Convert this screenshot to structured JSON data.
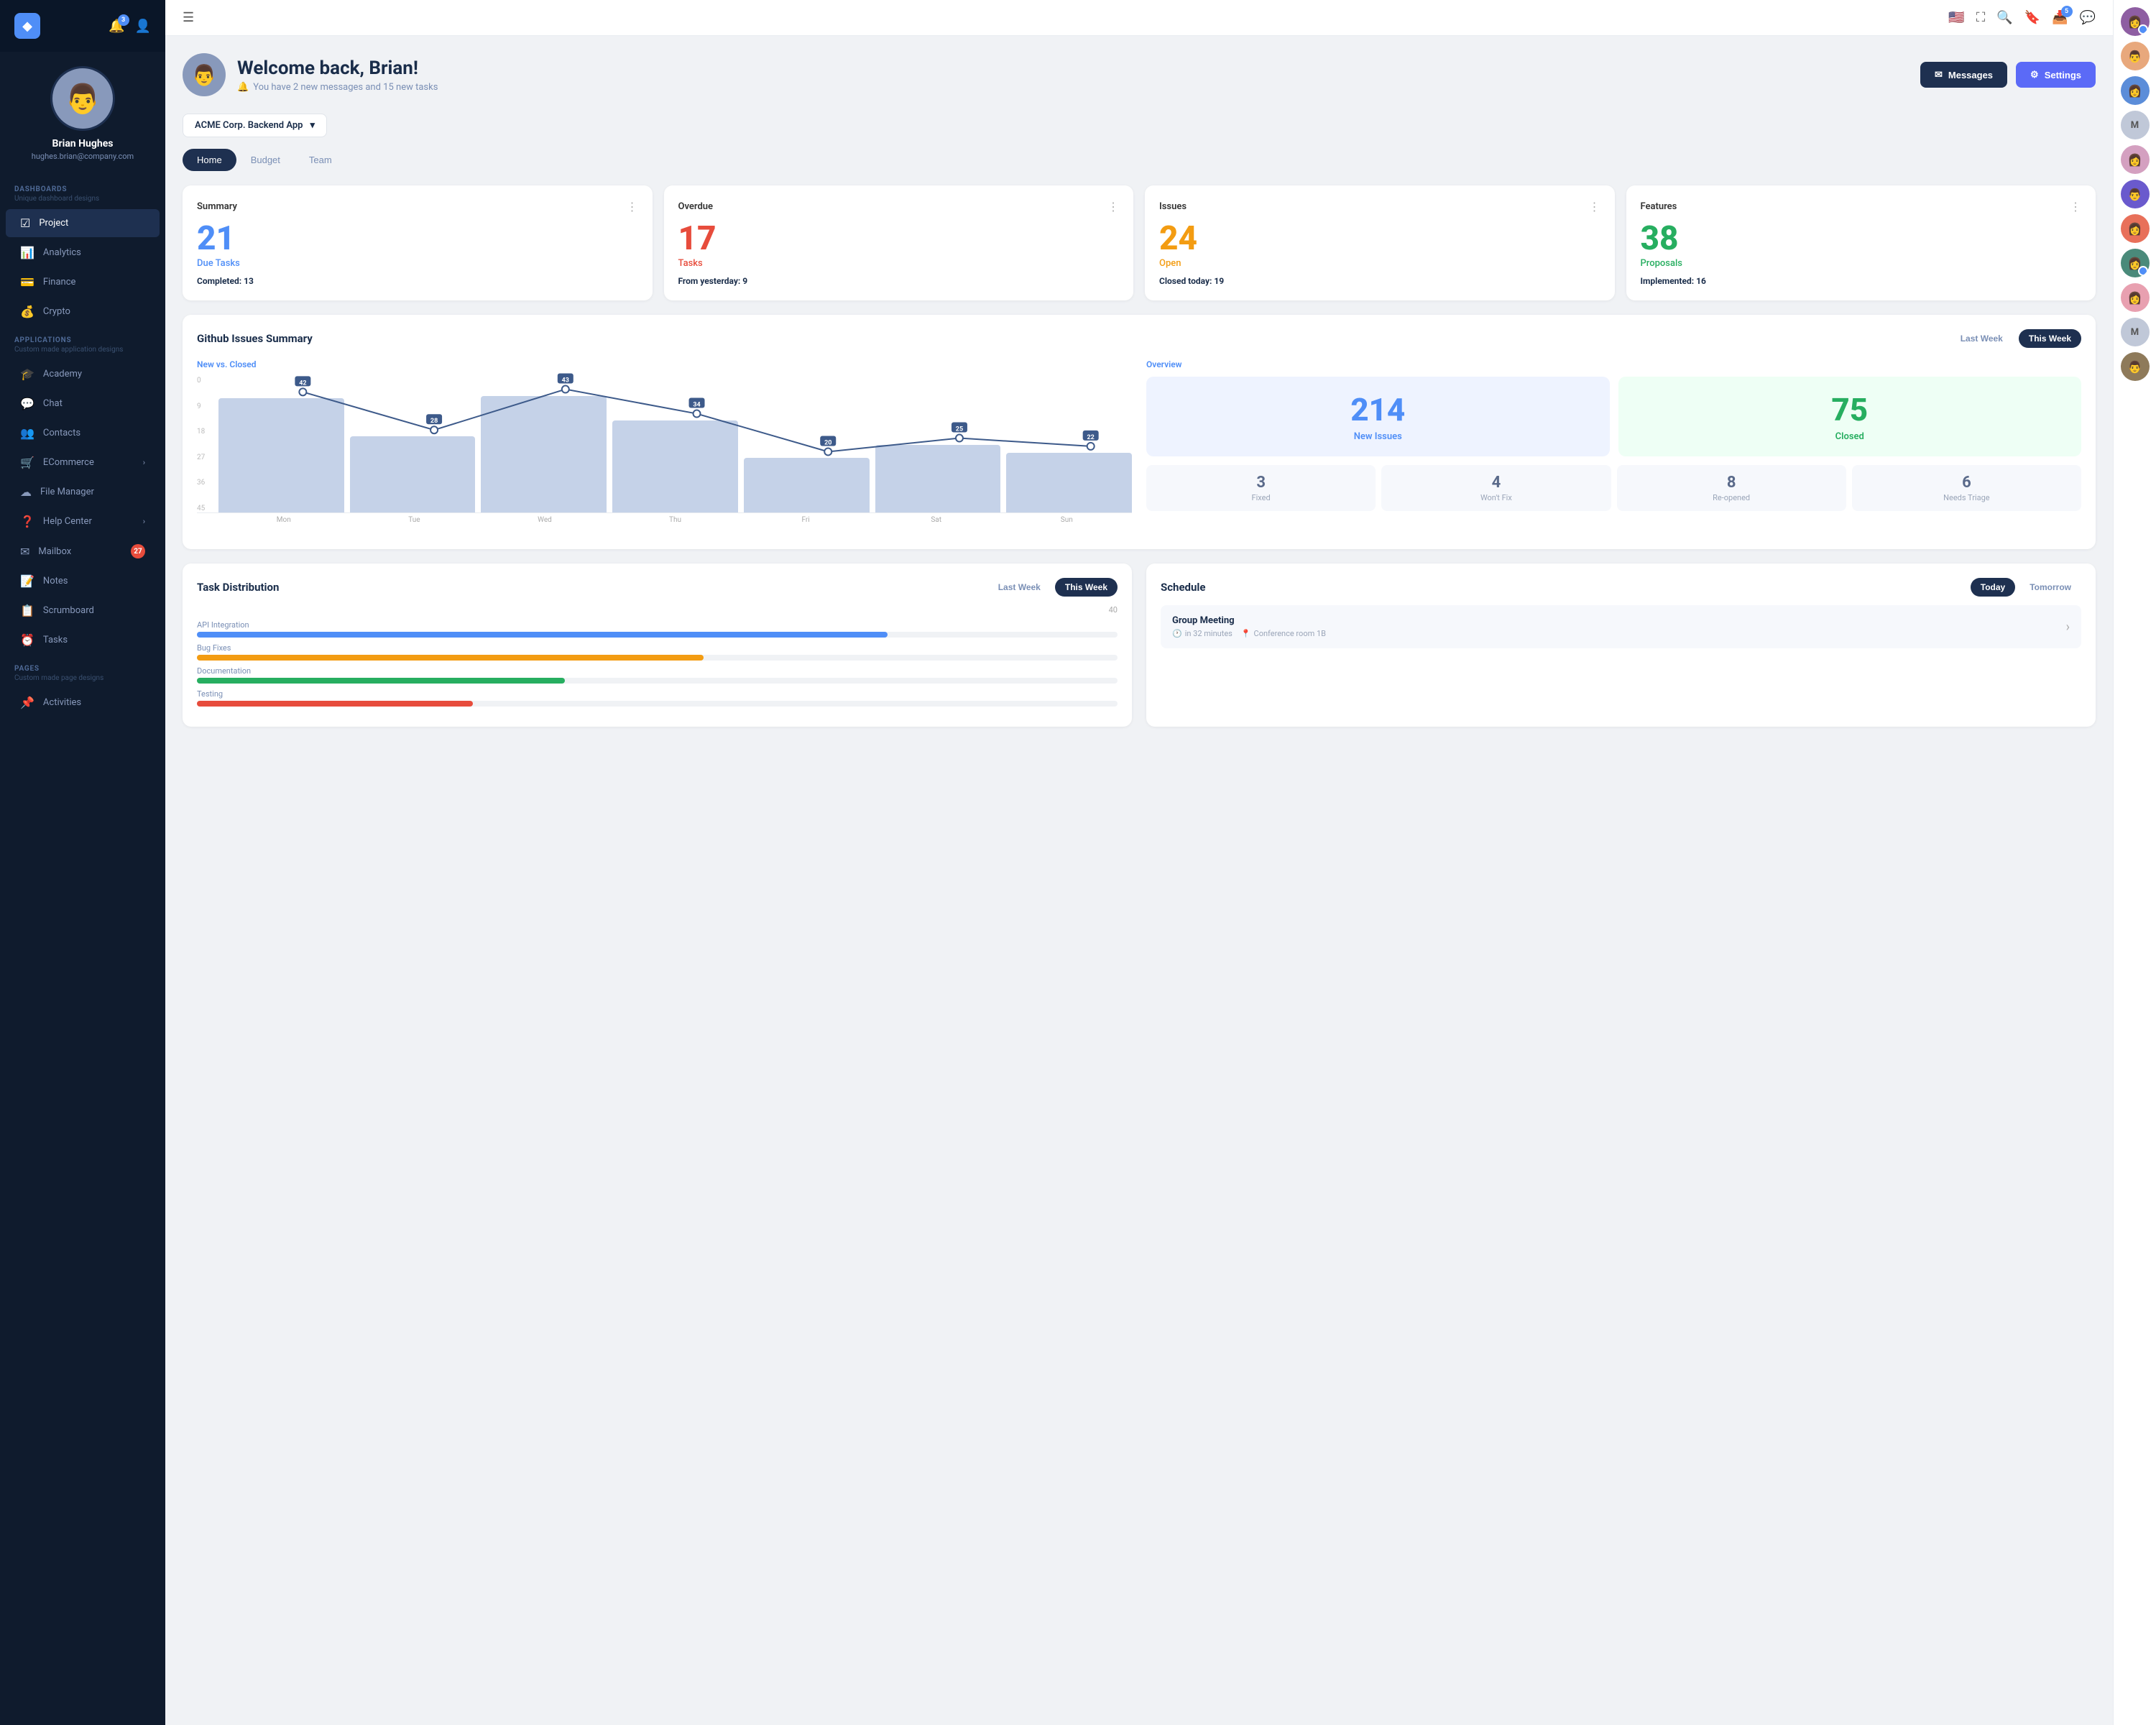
{
  "sidebar": {
    "logo": "◆",
    "notification_badge": "3",
    "user": {
      "name": "Brian Hughes",
      "email": "hughes.brian@company.com",
      "avatar_text": "🧑"
    },
    "dashboards_label": "DASHBOARDS",
    "dashboards_sub": "Unique dashboard designs",
    "nav_items": [
      {
        "id": "project",
        "icon": "☑",
        "label": "Project",
        "active": true
      },
      {
        "id": "analytics",
        "icon": "📊",
        "label": "Analytics"
      },
      {
        "id": "finance",
        "icon": "💳",
        "label": "Finance"
      },
      {
        "id": "crypto",
        "icon": "💰",
        "label": "Crypto"
      }
    ],
    "applications_label": "APPLICATIONS",
    "applications_sub": "Custom made application designs",
    "app_items": [
      {
        "id": "academy",
        "icon": "🎓",
        "label": "Academy"
      },
      {
        "id": "chat",
        "icon": "💬",
        "label": "Chat"
      },
      {
        "id": "contacts",
        "icon": "👥",
        "label": "Contacts"
      },
      {
        "id": "ecommerce",
        "icon": "🛒",
        "label": "ECommerce",
        "has_chevron": true
      },
      {
        "id": "file-manager",
        "icon": "☁",
        "label": "File Manager"
      },
      {
        "id": "help-center",
        "icon": "❓",
        "label": "Help Center",
        "has_chevron": true
      },
      {
        "id": "mailbox",
        "icon": "✉",
        "label": "Mailbox",
        "badge": "27"
      },
      {
        "id": "notes",
        "icon": "📝",
        "label": "Notes"
      },
      {
        "id": "scrumboard",
        "icon": "📋",
        "label": "Scrumboard"
      },
      {
        "id": "tasks",
        "icon": "⏰",
        "label": "Tasks"
      }
    ],
    "pages_label": "PAGES",
    "pages_sub": "Custom made page designs",
    "page_items": [
      {
        "id": "activities",
        "icon": "📌",
        "label": "Activities"
      }
    ]
  },
  "topbar": {
    "inbox_badge": "5"
  },
  "right_panel": {
    "avatars": [
      {
        "id": "user1",
        "color": "#8e5ea2",
        "dot": "blue",
        "text": "👩"
      },
      {
        "id": "user2",
        "color": "#e8a87c",
        "dot": "none",
        "text": "👨"
      },
      {
        "id": "user3",
        "color": "#5b8dd9",
        "dot": "green",
        "text": "👩"
      },
      {
        "id": "user4",
        "color": "#c0c8d8",
        "text": "M",
        "dot": "none"
      },
      {
        "id": "user5",
        "color": "#d4a0c0",
        "dot": "orange",
        "text": "👩"
      },
      {
        "id": "user6",
        "color": "#6a5acd",
        "dot": "none",
        "text": "👨"
      },
      {
        "id": "user7",
        "color": "#e8705a",
        "dot": "none",
        "text": "👩"
      },
      {
        "id": "user8",
        "color": "#4a8a7a",
        "dot": "blue",
        "text": "👩"
      },
      {
        "id": "user9",
        "color": "#e8a0b0",
        "dot": "none",
        "text": "👩"
      },
      {
        "id": "user10",
        "color": "#c0c8d8",
        "text": "M",
        "dot": "none"
      },
      {
        "id": "user11",
        "color": "#8e7a5a",
        "dot": "none",
        "text": "👨"
      }
    ]
  },
  "welcome": {
    "title": "Welcome back, Brian!",
    "subtitle": "You have 2 new messages and 15 new tasks",
    "messages_btn": "Messages",
    "settings_btn": "Settings"
  },
  "project_selector": {
    "label": "ACME Corp. Backend App"
  },
  "tabs": [
    "Home",
    "Budget",
    "Team"
  ],
  "active_tab": "Home",
  "stats": [
    {
      "title": "Summary",
      "number": "21",
      "number_color": "blue",
      "label": "Due Tasks",
      "label_color": "blue",
      "sub_text": "Completed:",
      "sub_value": "13"
    },
    {
      "title": "Overdue",
      "number": "17",
      "number_color": "red",
      "label": "Tasks",
      "label_color": "red",
      "sub_text": "From yesterday:",
      "sub_value": "9"
    },
    {
      "title": "Issues",
      "number": "24",
      "number_color": "orange",
      "label": "Open",
      "label_color": "orange",
      "sub_text": "Closed today:",
      "sub_value": "19"
    },
    {
      "title": "Features",
      "number": "38",
      "number_color": "green",
      "label": "Proposals",
      "label_color": "green",
      "sub_text": "Implemented:",
      "sub_value": "16"
    }
  ],
  "github_section": {
    "title": "Github Issues Summary",
    "toggle_last_week": "Last Week",
    "toggle_this_week": "This Week",
    "chart_subtitle": "New vs. Closed",
    "days": [
      "Mon",
      "Tue",
      "Wed",
      "Thu",
      "Fri",
      "Sat",
      "Sun"
    ],
    "bar_values": [
      42,
      28,
      43,
      34,
      20,
      25,
      22
    ],
    "y_labels": [
      "0",
      "9",
      "18",
      "27",
      "36",
      "45"
    ],
    "line_points": [
      42,
      28,
      43,
      34,
      20,
      25,
      22
    ],
    "overview_title": "Overview",
    "new_issues_number": "214",
    "new_issues_label": "New Issues",
    "closed_number": "75",
    "closed_label": "Closed",
    "bottom_stats": [
      {
        "number": "3",
        "label": "Fixed"
      },
      {
        "number": "4",
        "label": "Won't Fix"
      },
      {
        "number": "8",
        "label": "Re-opened"
      },
      {
        "number": "6",
        "label": "Needs Triage"
      }
    ]
  },
  "task_distribution": {
    "title": "Task Distribution",
    "toggle_last_week": "Last Week",
    "toggle_this_week": "This Week",
    "bars": [
      {
        "label": "API Integration",
        "percent": 75,
        "color": "#4f8ef7"
      },
      {
        "label": "Bug Fixes",
        "percent": 55,
        "color": "#f39c12"
      },
      {
        "label": "Documentation",
        "percent": 40,
        "color": "#27ae60"
      },
      {
        "label": "Testing",
        "percent": 30,
        "color": "#e74c3c"
      }
    ],
    "max_label": "40"
  },
  "schedule": {
    "title": "Schedule",
    "toggle_today": "Today",
    "toggle_tomorrow": "Tomorrow",
    "item": {
      "title": "Group Meeting",
      "time": "in 32 minutes",
      "location": "Conference room 1B"
    }
  }
}
